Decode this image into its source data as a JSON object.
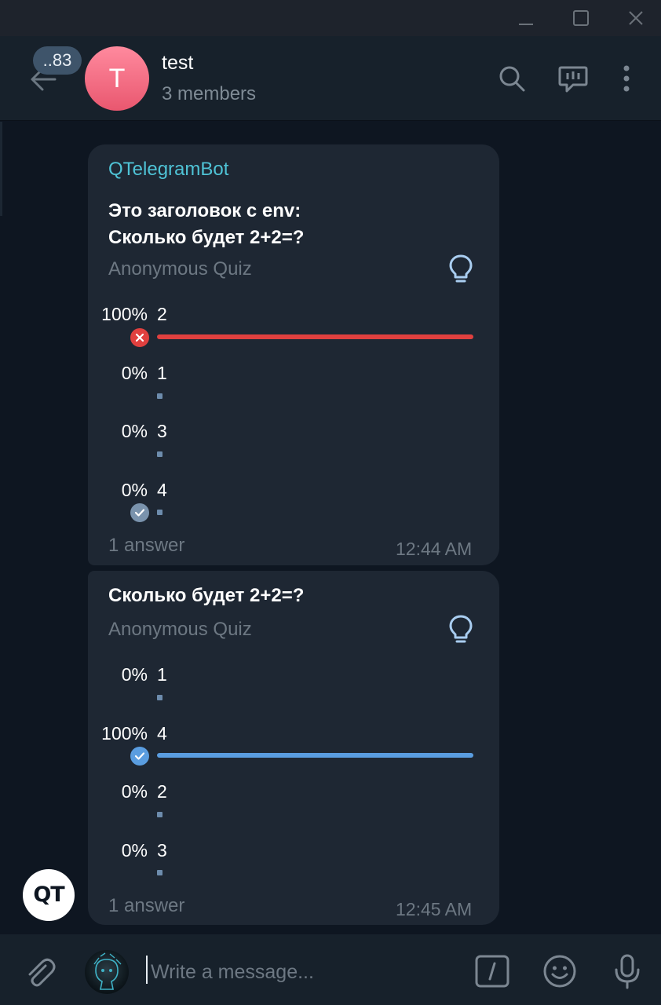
{
  "header": {
    "unread_badge": "..83",
    "avatar_letter": "T",
    "title": "test",
    "subtitle": "3 members"
  },
  "messages": [
    {
      "sender": "QTelegramBot",
      "question_line1": "Это заголовок с env:",
      "question_line2": "Сколько будет 2+2=?",
      "quiz_type": "Anonymous Quiz",
      "options": [
        {
          "percent": "100%",
          "label": "2",
          "fraction": 1.0,
          "state": "wrong"
        },
        {
          "percent": "0%",
          "label": "1",
          "fraction": 0.0,
          "state": "none"
        },
        {
          "percent": "0%",
          "label": "3",
          "fraction": 0.0,
          "state": "none"
        },
        {
          "percent": "0%",
          "label": "4",
          "fraction": 0.0,
          "state": "correct"
        }
      ],
      "answers": "1 answer",
      "time": "12:44 AM"
    },
    {
      "question": "Сколько будет 2+2=?",
      "quiz_type": "Anonymous Quiz",
      "options": [
        {
          "percent": "0%",
          "label": "1",
          "fraction": 0.0,
          "state": "none"
        },
        {
          "percent": "100%",
          "label": "4",
          "fraction": 1.0,
          "state": "chosen-correct"
        },
        {
          "percent": "0%",
          "label": "2",
          "fraction": 0.0,
          "state": "none"
        },
        {
          "percent": "0%",
          "label": "3",
          "fraction": 0.0,
          "state": "none"
        }
      ],
      "answers": "1 answer",
      "time": "12:45 AM"
    }
  ],
  "sender_avatar": "QT",
  "composer": {
    "placeholder": "Write a message..."
  },
  "colors": {
    "background": "#0e1621",
    "bubble": "#1e2733",
    "sender": "#4fc3d6",
    "wrong": "#e0403f",
    "correct": "#5a9de0",
    "muted": "#6d7883"
  }
}
